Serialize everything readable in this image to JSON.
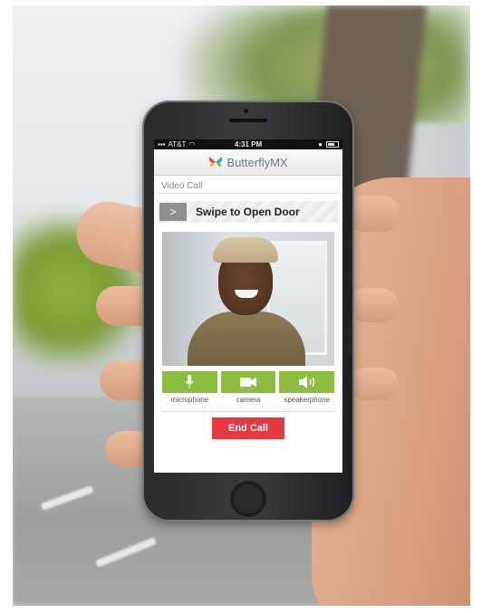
{
  "status_bar": {
    "carrier": "AT&T",
    "time": "4:31 PM"
  },
  "app": {
    "brand": "ButterflyMX"
  },
  "call": {
    "section_label": "Video Call",
    "swipe_label": "Swipe to Open Door",
    "swipe_arrow": ">"
  },
  "controls": [
    {
      "label": "microphone",
      "icon": "microphone-icon"
    },
    {
      "label": "camera",
      "icon": "camera-icon"
    },
    {
      "label": "speakerphone",
      "icon": "speaker-icon"
    }
  ],
  "end_call_label": "End Call",
  "colors": {
    "control_green": "#8cbd3e",
    "end_call_red": "#e63944"
  }
}
